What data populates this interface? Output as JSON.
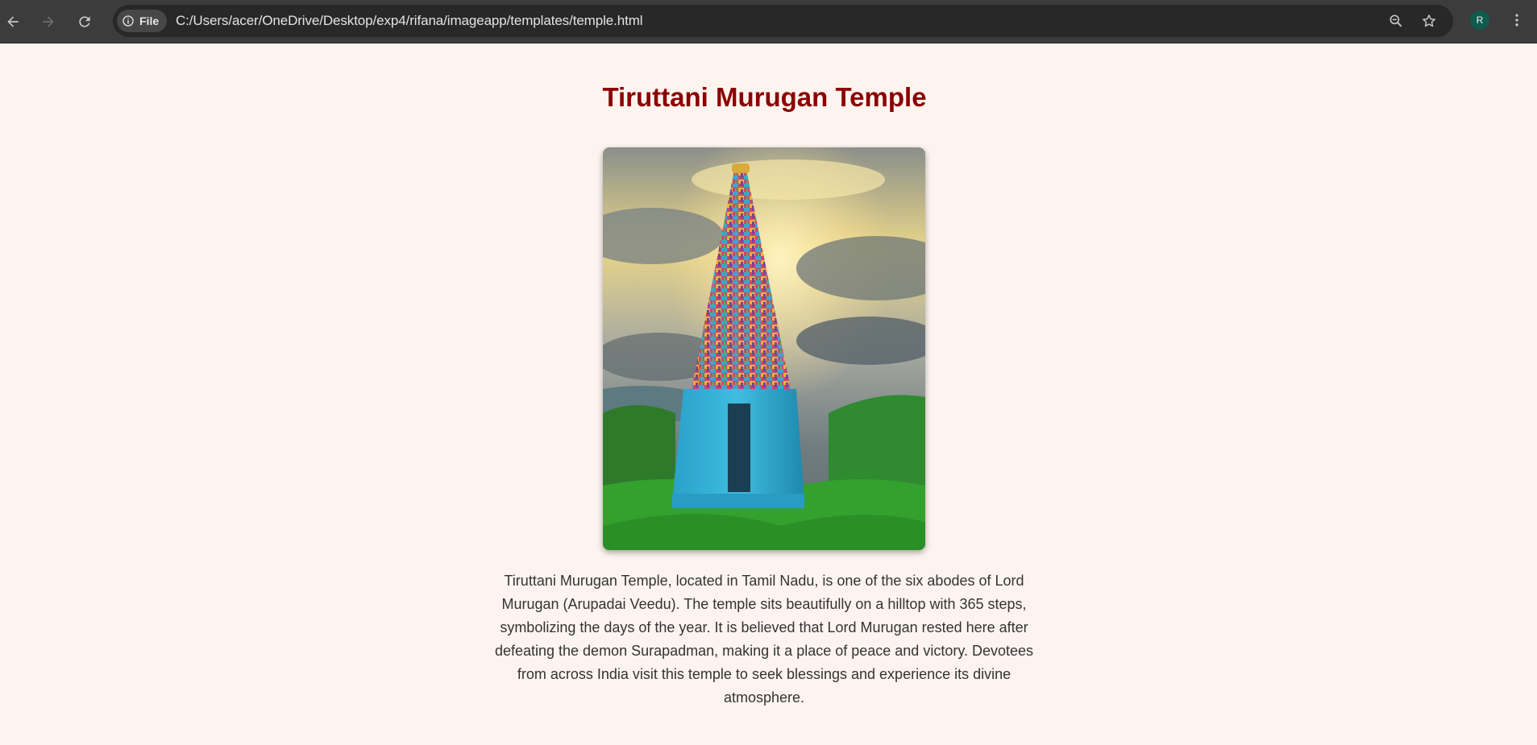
{
  "browser": {
    "site_chip_label": "File",
    "url": "C:/Users/acer/OneDrive/Desktop/exp4/rifana/imageapp/templates/temple.html",
    "profile_initial": "R",
    "icons": [
      "back-arrow-icon",
      "forward-arrow-icon",
      "reload-icon",
      "info-icon",
      "zoom-icon",
      "star-icon",
      "kebab-menu-icon"
    ]
  },
  "page": {
    "title": "Tiruttani Murugan Temple",
    "description": "Tiruttani Murugan Temple, located in Tamil Nadu, is one of the six abodes of Lord Murugan (Arupadai Veedu). The temple sits beautifully on a hilltop with 365 steps, symbolizing the days of the year. It is believed that Lord Murugan rested here after defeating the demon Surapadman, making it a place of peace and victory. Devotees from across India visit this temple to seek blessings and experience its divine atmosphere."
  },
  "colors": {
    "page_background": "#fdf4ef",
    "title": "#8b0000",
    "body_text": "#333333",
    "toolbar": "#3c3c3c",
    "omnibox": "#282828",
    "avatar": "#0f5b4e"
  }
}
